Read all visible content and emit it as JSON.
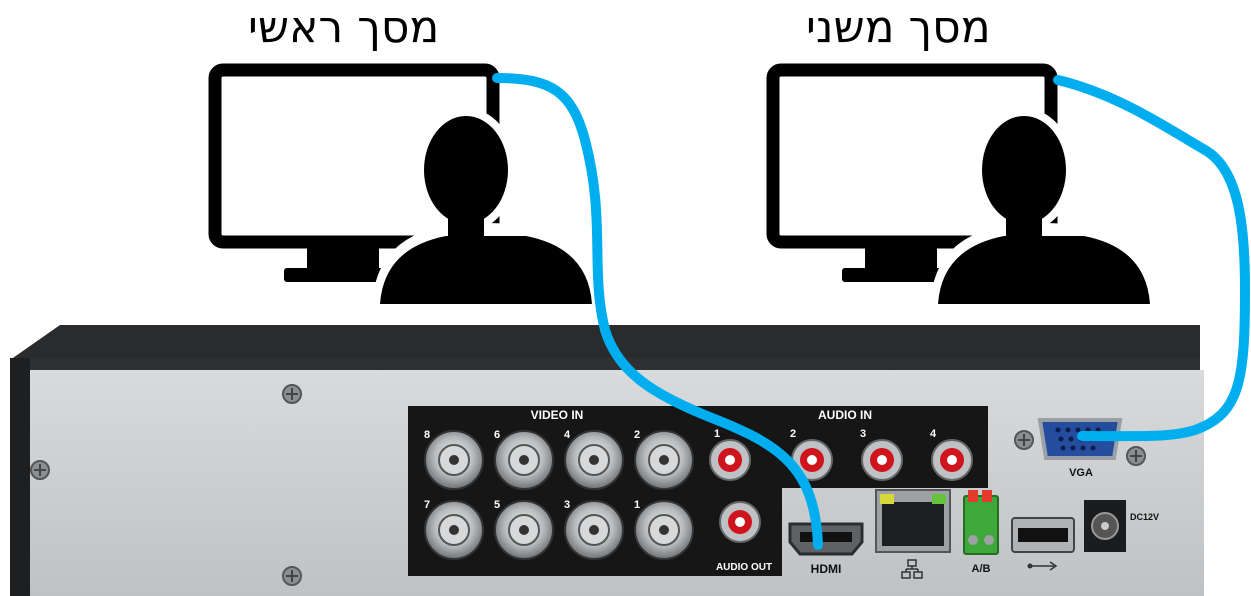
{
  "monitors": {
    "main_label": "מסך ראשי",
    "secondary_label": "מסך משני"
  },
  "dvr": {
    "video_in_label": "VIDEO IN",
    "audio_in_label": "AUDIO IN",
    "audio_out_label": "AUDIO OUT",
    "hdmi_label": "HDMI",
    "vga_label": "VGA",
    "ab_label": "A/B",
    "dc_label_line1": "DC12V",
    "video_ports_top": [
      "8",
      "6",
      "4",
      "2"
    ],
    "video_ports_bottom": [
      "7",
      "5",
      "3",
      "1"
    ],
    "audio_in_ports": [
      "1",
      "2",
      "3",
      "4"
    ]
  },
  "colors": {
    "cable": "#00aeef",
    "chassis": "#c9ccce",
    "panel": "#161616"
  }
}
